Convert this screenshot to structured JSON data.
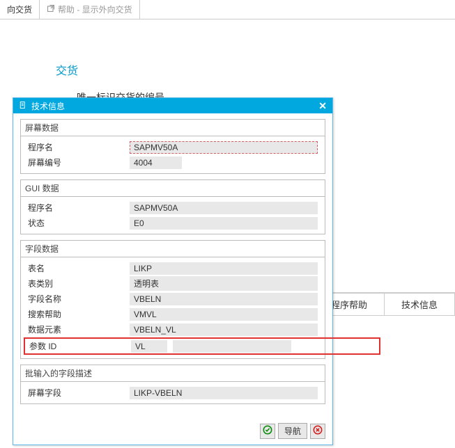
{
  "tabs": {
    "left": "向交货",
    "right": "帮助 - 显示外向交货"
  },
  "background": {
    "heading": "交货",
    "description": "唯一标识交货的编号。",
    "buttons": {
      "appHelp": "应用程序帮助",
      "techInfo": "技术信息"
    }
  },
  "dialog": {
    "title": "技术信息",
    "screenData": {
      "header": "屏幕数据",
      "progNameLabel": "程序名",
      "progName": "SAPMV50A",
      "screenNoLabel": "屏幕编号",
      "screenNo": "4004"
    },
    "guiData": {
      "header": "GUI 数据",
      "progNameLabel": "程序名",
      "progName": "SAPMV50A",
      "statusLabel": "状态",
      "status": "E0"
    },
    "fieldData": {
      "header": "字段数据",
      "tableLabel": "表名",
      "table": "LIKP",
      "tableCatLabel": "表类别",
      "tableCat": "透明表",
      "fieldNameLabel": "字段名称",
      "fieldName": "VBELN",
      "searchHelpLabel": "搜索帮助",
      "searchHelp": "VMVL",
      "dataElemLabel": "数据元素",
      "dataElem": "VBELN_VL",
      "paramIdLabel": "参数 ID",
      "paramId": "VL"
    },
    "batchInput": {
      "header": "批输入的字段描述",
      "screenFieldLabel": "屏幕字段",
      "screenField": "LIKP-VBELN"
    },
    "footer": {
      "nav": "导航"
    }
  }
}
